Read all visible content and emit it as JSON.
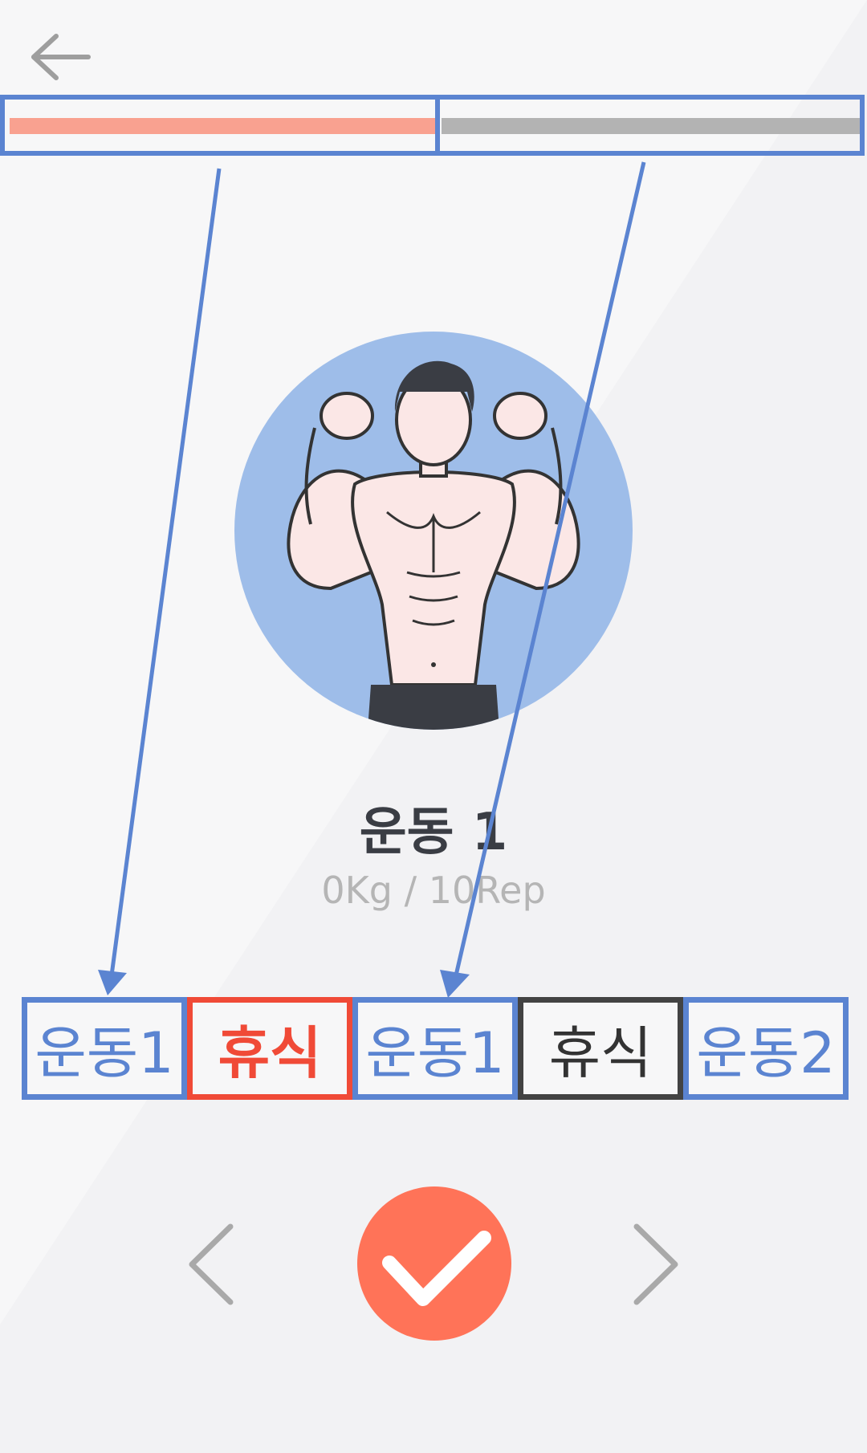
{
  "header": {
    "back_icon": "arrow-left-icon"
  },
  "progress": {
    "segments": [
      {
        "state": "current",
        "fill_fraction": 1.0,
        "color": "#f9a190"
      },
      {
        "state": "upcoming",
        "fill_fraction": 1.0,
        "color": "#b3b3b3"
      }
    ],
    "frame_color": "#5b84d1"
  },
  "exercise": {
    "image": "flexing-man-illustration",
    "name": "운동 1",
    "detail": "0Kg / 10Rep"
  },
  "sequence": [
    {
      "label": "운동1",
      "type": "exercise"
    },
    {
      "label": "휴식",
      "type": "rest-active"
    },
    {
      "label": "운동1",
      "type": "exercise"
    },
    {
      "label": "휴식",
      "type": "rest"
    },
    {
      "label": "운동2",
      "type": "exercise"
    }
  ],
  "controls": {
    "prev_icon": "chevron-left-icon",
    "complete_icon": "checkmark-icon",
    "next_icon": "chevron-right-icon",
    "accent_color": "#ff7358"
  }
}
